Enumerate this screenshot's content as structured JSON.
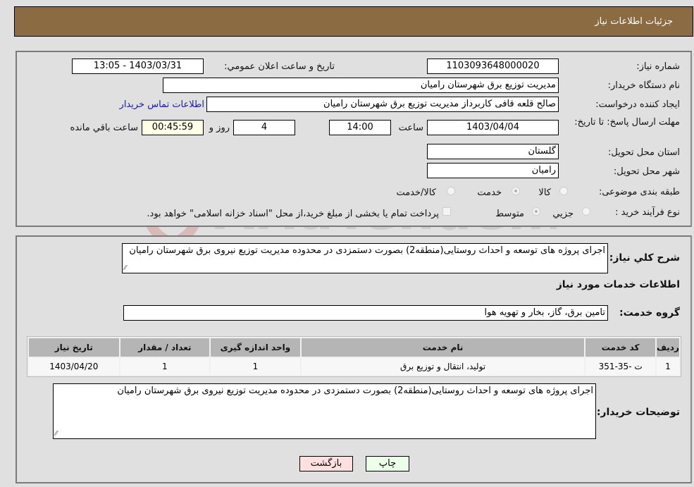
{
  "header": {
    "title": "جزئیات اطلاعات نیاز"
  },
  "form": {
    "need_number_label": "شماره نیاز:",
    "need_number": "1103093648000020",
    "announce_label": "تاریخ و ساعت اعلان عمومي:",
    "announce_value": "1403/03/31 - 13:05",
    "buyer_org_label": "نام دستگاه خریدار:",
    "buyer_org": "مدیریت توزیع برق شهرستان رامیان",
    "creator_label": "ایجاد کننده درخواست:",
    "creator": "صالح قلعه قافی کاربرداز مدیریت توزیع برق شهرستان رامیان",
    "contact_link": "اطلاعات تماس خریدار",
    "deadline_label": "مهلت ارسال پاسخ: تا تاریخ:",
    "deadline_date": "1403/04/04",
    "time_label": "ساعت",
    "deadline_time": "14:00",
    "days_value": "4",
    "days_label": "روز و",
    "remaining_time": "00:45:59",
    "remaining_label": "ساعت باقي مانده",
    "province_label": "استان محل تحویل:",
    "province": "گلستان",
    "city_label": "شهر محل تحویل:",
    "city": "رامیان",
    "category_label": "طبقه بندی موضوعی:",
    "category_options": [
      {
        "label": "کالا",
        "selected": false
      },
      {
        "label": "خدمت",
        "selected": true
      },
      {
        "label": "کالا/خدمت",
        "selected": false
      }
    ],
    "process_label": "نوع فرآیند خرید :",
    "process_options": [
      {
        "label": "جزيي",
        "selected": false
      },
      {
        "label": "متوسط",
        "selected": true
      }
    ],
    "payment_checkbox_label": "پرداخت تمام یا بخشی از مبلغ خرید،از محل \"اسناد خزانه اسلامی\" خواهد بود.",
    "payment_checked": false
  },
  "details": {
    "summary_label": "شرح کلي نیاز:",
    "summary": "اجرای پروژه های توسعه و احداث روستایی(منطقه2) بصورت دستمزدی در محدوده مدیریت توزیع نیروی برق شهرستان رامیان",
    "services_heading": "اطلاعات خدمات مورد نیاز",
    "service_group_label": "گروه خدمت:",
    "service_group": "تامین برق، گاز، بخار و تهویه هوا",
    "table": {
      "headers": [
        "ردیف",
        "کد خدمت",
        "نام خدمت",
        "واحد اندازه گیری",
        "تعداد / مقدار",
        "تاریخ نیاز"
      ],
      "rows": [
        [
          "1",
          "ت -35-351",
          "تولید، انتقال و توزیع برق",
          "1",
          "1",
          "1403/04/20"
        ]
      ]
    },
    "buyer_notes_label": "توضیحات خریدار:",
    "buyer_notes": "اجرای پروژه های توسعه و احداث روستایی(منطقه2) بصورت دستمزدی در محدوده مدیریت توزیع نیروی برق شهرستان رامیان"
  },
  "buttons": {
    "print": "چاپ",
    "back": "بازگشت"
  },
  "watermark": {
    "text": "AriaTender.neT"
  }
}
